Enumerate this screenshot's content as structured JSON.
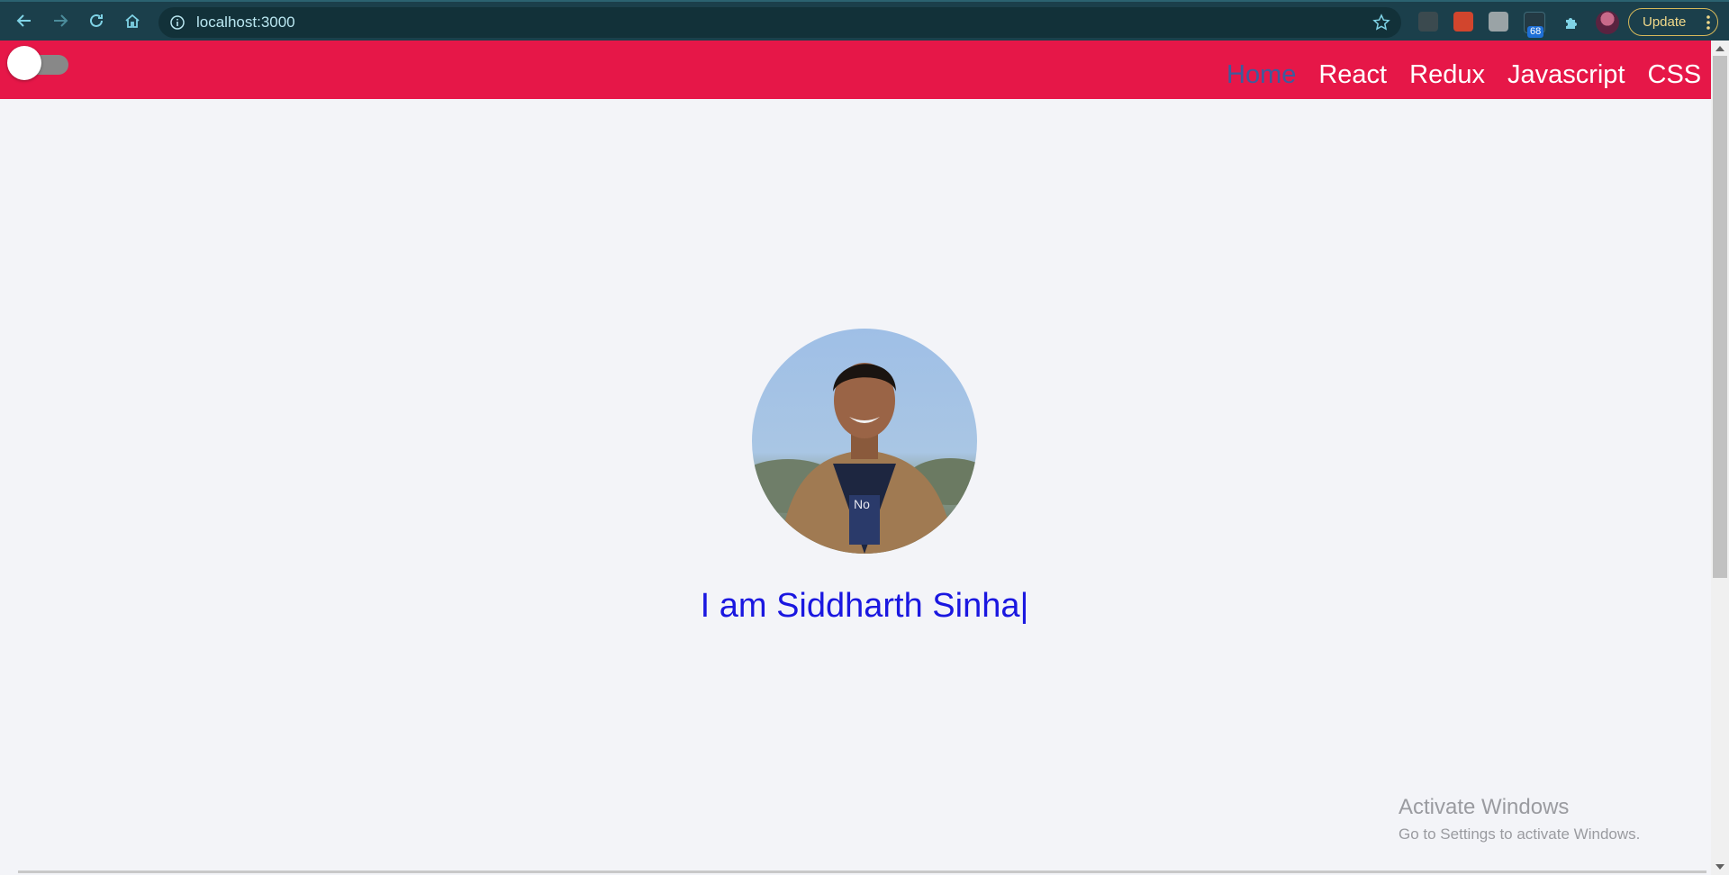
{
  "browser": {
    "url": "localhost:3000",
    "update_label": "Update",
    "extension_badge": "68",
    "icons": [
      "back-arrow-icon",
      "forward-arrow-icon",
      "reload-icon",
      "home-icon",
      "info-icon",
      "star-icon",
      "extensions-puzzle-icon",
      "more-vert-icon"
    ]
  },
  "navbar": {
    "background": "#e61748",
    "links": [
      "Home",
      "React",
      "Redux",
      "Javascript",
      "CSS"
    ],
    "active_link": "Home",
    "theme_toggle_on": false
  },
  "hero": {
    "title": "I am Siddharth Sinha",
    "cursor": "|",
    "title_color": "#1a17e0"
  },
  "watermark": {
    "line1": "Activate Windows",
    "line2": "Go to Settings to activate Windows."
  }
}
